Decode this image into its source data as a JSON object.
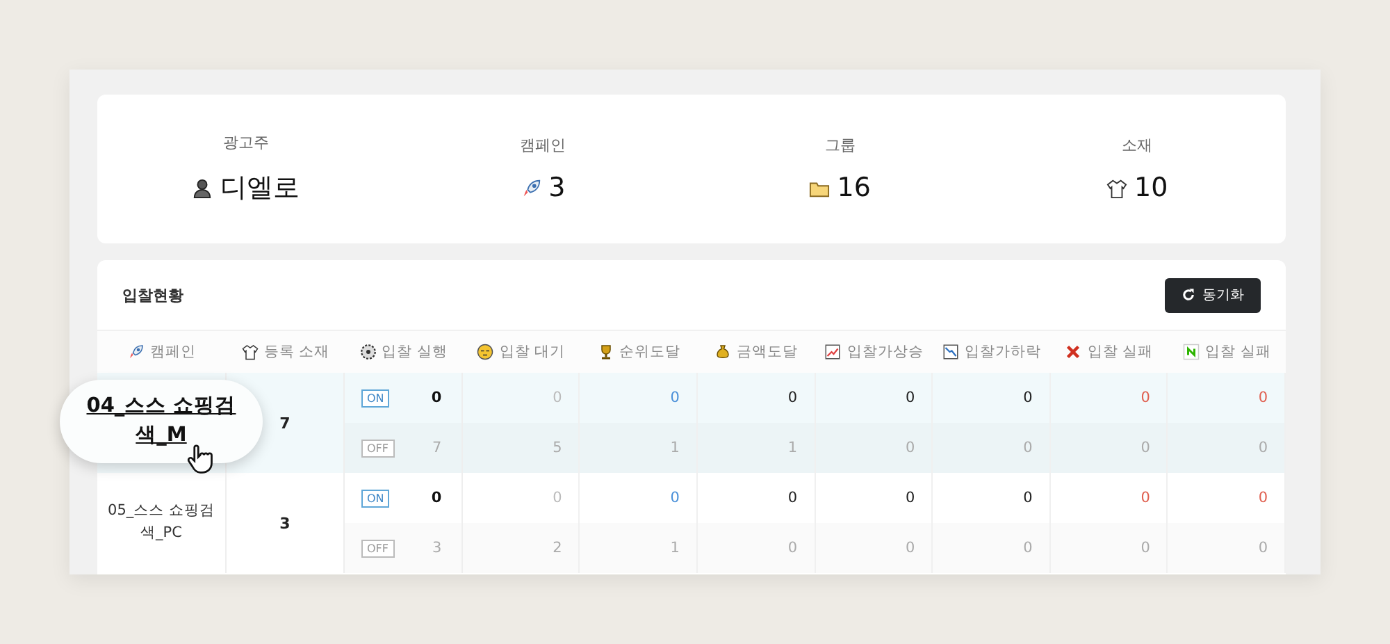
{
  "summary": [
    {
      "label": "광고주",
      "value": "디엘로"
    },
    {
      "label": "캠페인",
      "value": "3"
    },
    {
      "label": "그룹",
      "value": "16"
    },
    {
      "label": "소재",
      "value": "10"
    }
  ],
  "bid_status": {
    "title": "입찰현황",
    "sync_button": "동기화",
    "columns": [
      {
        "label": "캠페인"
      },
      {
        "label": "등록 소재"
      },
      {
        "label": "입찰 실행",
        "kind": "strong"
      },
      {
        "label": "입찰 대기",
        "kind": "muted"
      },
      {
        "label": "순위도달",
        "kind": "blue"
      },
      {
        "label": "금액도달",
        "kind": "dark"
      },
      {
        "label": "입찰가상승",
        "kind": "dark"
      },
      {
        "label": "입찰가하락",
        "kind": "dark"
      },
      {
        "label": "입찰 실패",
        "kind": "red"
      },
      {
        "label": "입찰 실패",
        "kind": "red"
      }
    ],
    "rows": [
      {
        "campaign": "04_스스 쇼핑검색_M",
        "zoomed": true,
        "selected": true,
        "creatives": "7",
        "lines": [
          {
            "status": "ON",
            "on": true,
            "values": [
              "0",
              "0",
              "0",
              "0",
              "0",
              "0",
              "0",
              "0"
            ]
          },
          {
            "status": "OFF",
            "on": false,
            "values": [
              "7",
              "5",
              "1",
              "1",
              "0",
              "0",
              "0",
              "0"
            ]
          }
        ]
      },
      {
        "campaign": "05_스스 쇼핑검색_PC",
        "zoomed": false,
        "selected": false,
        "creatives": "3",
        "lines": [
          {
            "status": "ON",
            "on": true,
            "values": [
              "0",
              "0",
              "0",
              "0",
              "0",
              "0",
              "0",
              "0"
            ]
          },
          {
            "status": "OFF",
            "on": false,
            "values": [
              "3",
              "2",
              "1",
              "0",
              "0",
              "0",
              "0",
              "0"
            ]
          }
        ]
      }
    ]
  }
}
